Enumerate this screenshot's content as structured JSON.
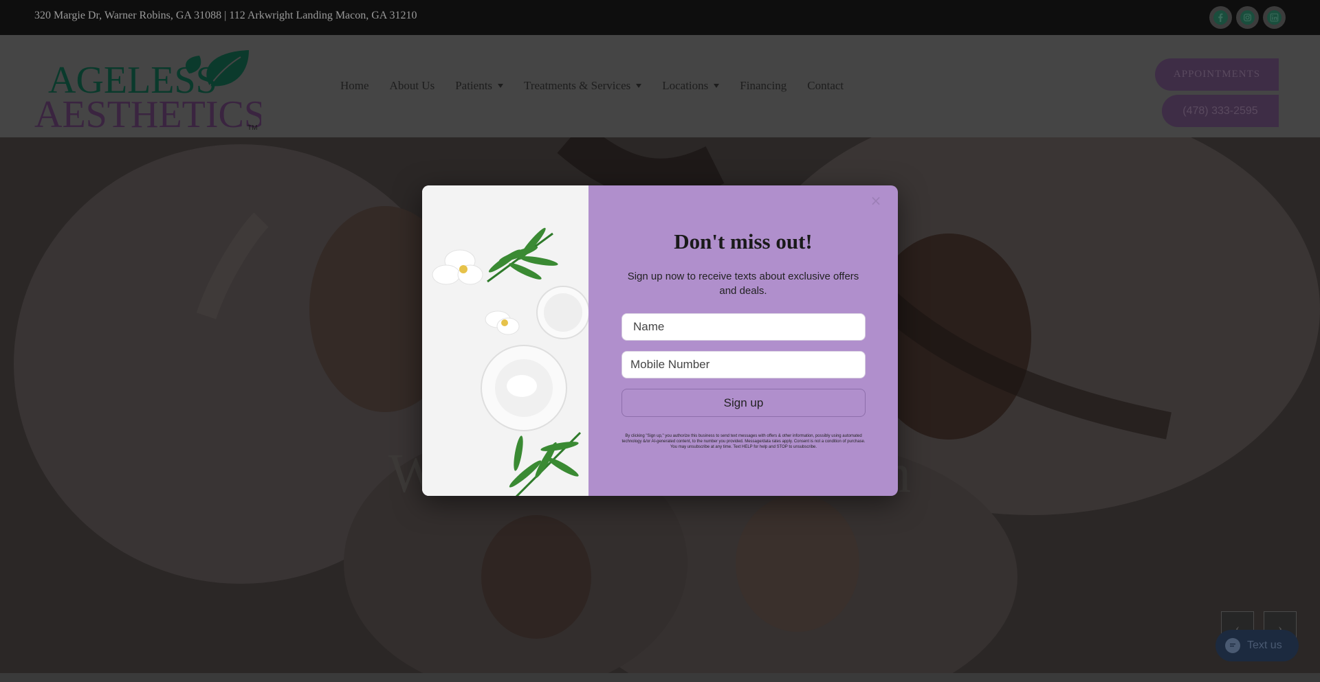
{
  "topbar": {
    "address": "320 Margie Dr, Warner Robins, GA 31088 | 112 Arkwright Landing Macon, GA 31210",
    "social_icons": [
      "facebook-icon",
      "instagram-icon",
      "linkedin-icon"
    ]
  },
  "header": {
    "logo_line1": "AGELESS",
    "logo_line2": "AESTHETICS",
    "logo_tm": "TM",
    "nav": [
      {
        "label": "Home"
      },
      {
        "label": "About Us"
      },
      {
        "label": "Patients"
      },
      {
        "label": "Treatments & Services"
      },
      {
        "label": "Locations"
      },
      {
        "label": "Financing"
      },
      {
        "label": "Contact"
      }
    ],
    "appointments_label": "APPOINTMENTS",
    "phone_label": "(478) 333-2595"
  },
  "hero": {
    "heading_partial_left": "W",
    "heading_partial_right": "n",
    "prev_arrow": "‹",
    "next_arrow": "›"
  },
  "modal": {
    "title": "Don't miss out!",
    "subtitle": "Sign up now to receive texts about exclusive offers and deals.",
    "name_placeholder": "Name",
    "phone_placeholder": "Mobile Number",
    "signup_label": "Sign up",
    "legal": "By clicking \"Sign up,\" you authorize this business to send text messages with offers & other information, possibly using automated technology &/or AI-generated content, to the number you provided. Message/data rates apply. Consent is not a condition of purchase. You may unsubscribe at any time. Text HELP for help and STOP to unsubscribe.",
    "close_glyph": "×"
  },
  "chat": {
    "label": "Text us"
  },
  "colors": {
    "brand_purple": "#b08fcc",
    "brand_green": "#0f7a5c",
    "logo_purple": "#6e3c7c"
  }
}
